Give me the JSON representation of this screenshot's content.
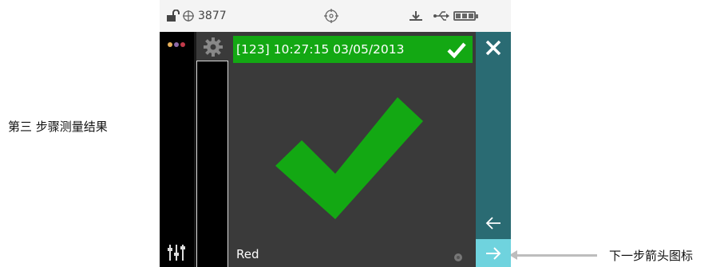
{
  "annotations": {
    "left_label": "第三 步骤测量结果",
    "right_label": "下一步箭头图标"
  },
  "status_bar": {
    "measurement_count": "3877",
    "icons": [
      "unlock-icon",
      "crosshair-icon",
      "target-icon",
      "download-icon",
      "usb-icon",
      "battery-icon"
    ]
  },
  "result": {
    "title": "[123] 10:27:15 03/05/2013",
    "status": "pass",
    "color_name": "Red"
  },
  "colors": {
    "status_bar_bg": "#f4f4f4",
    "screen_bg": "#3a3a3a",
    "success_green": "#13a813",
    "teal_sidebar": "#2a6b73",
    "next_button": "#6fd3de",
    "annotation_arrow": "#bdbdbd"
  },
  "nav": {
    "close_icon": "close-icon",
    "back_icon": "arrow-left-icon",
    "next_icon": "arrow-right-icon"
  }
}
